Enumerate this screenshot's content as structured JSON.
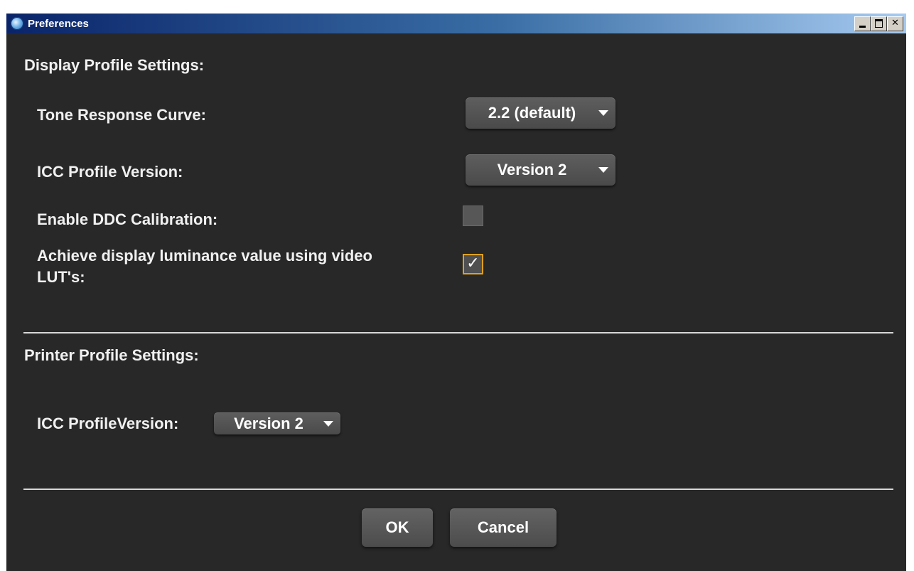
{
  "window": {
    "title": "Preferences"
  },
  "display_section": {
    "heading": "Display Profile Settings:",
    "tone_response_curve": {
      "label": "Tone Response Curve:",
      "value": "2.2 (default)"
    },
    "icc_profile_version": {
      "label": "ICC Profile Version:",
      "value": "Version 2"
    },
    "enable_ddc": {
      "label": "Enable DDC Calibration:",
      "checked": false
    },
    "achieve_luminance": {
      "label_line1": "Achieve display luminance value using video",
      "label_line2": "LUT's:",
      "checked": true,
      "check_glyph": "✓"
    }
  },
  "printer_section": {
    "heading": "Printer Profile Settings:",
    "icc_profile_version": {
      "label": "ICC ProfileVersion:",
      "value": "Version 2"
    }
  },
  "buttons": {
    "ok": "OK",
    "cancel": "Cancel"
  },
  "colors": {
    "background": "#282828",
    "titlebar_start": "#0a246a",
    "titlebar_end": "#a6caf0",
    "checkbox_focus": "#e0a020"
  }
}
